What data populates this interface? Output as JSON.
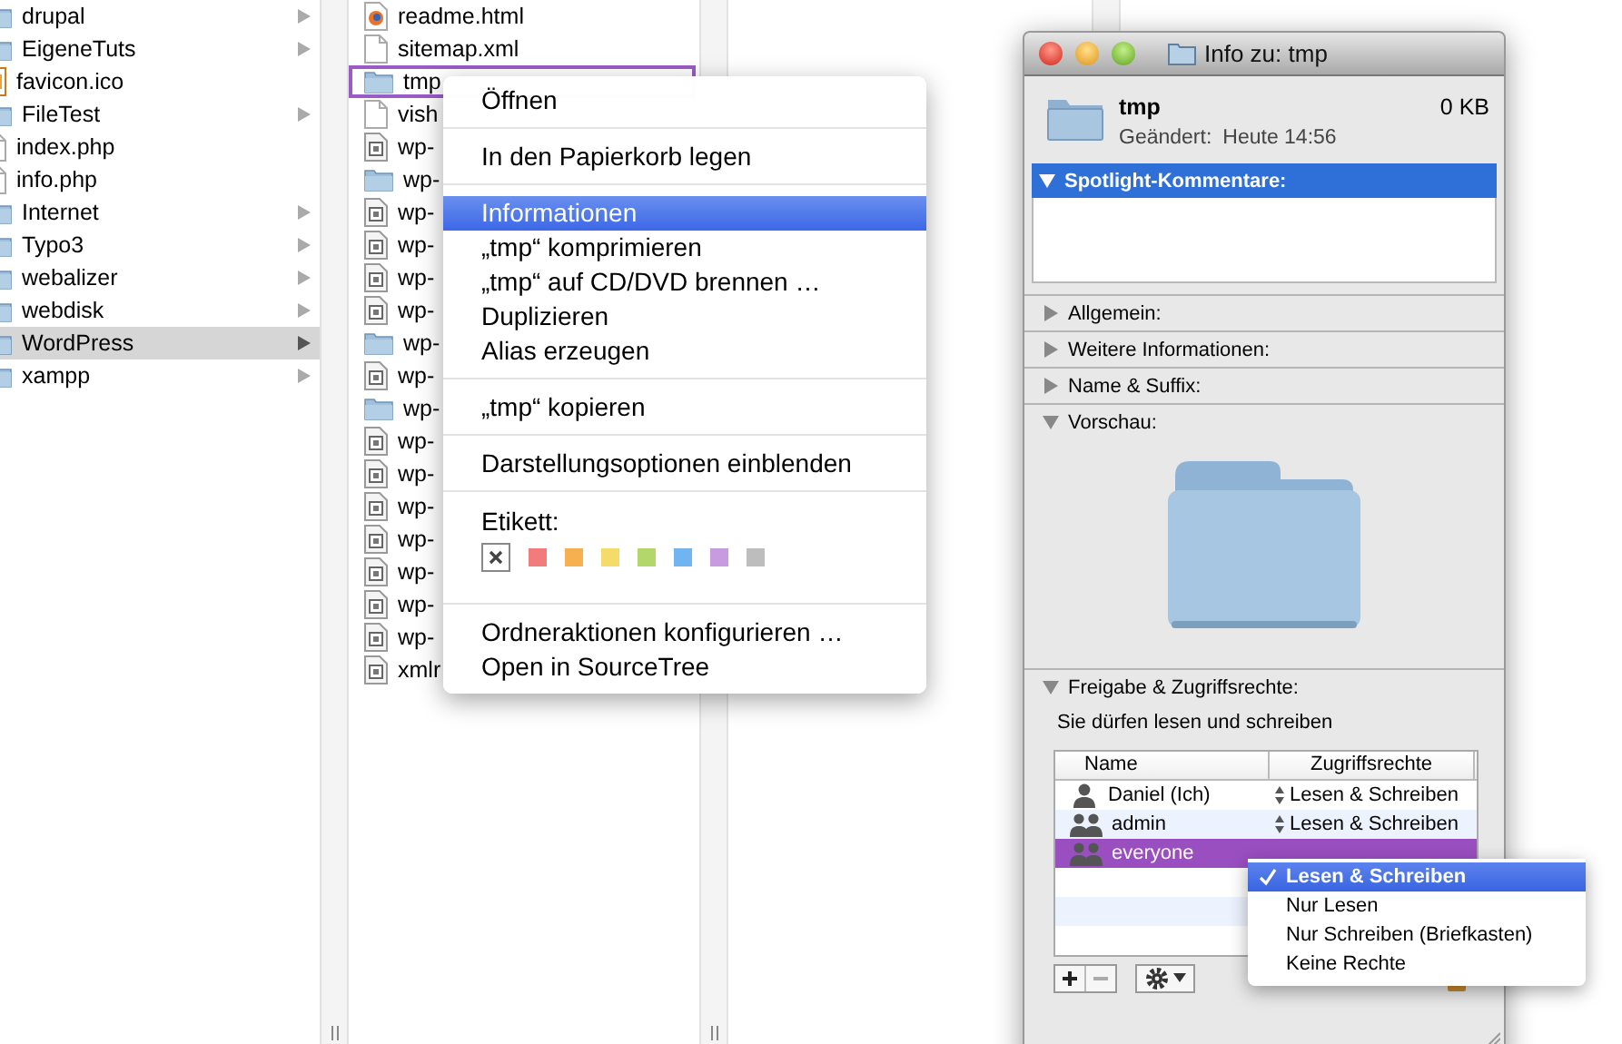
{
  "columns": [
    {
      "items": [
        {
          "name": "drupal",
          "kind": "folder",
          "selected": false
        },
        {
          "name": "EigeneTuts",
          "kind": "folder",
          "selected": false
        },
        {
          "name": "favicon.ico",
          "kind": "image",
          "selected": false
        },
        {
          "name": "FileTest",
          "kind": "folder",
          "selected": false
        },
        {
          "name": "index.php",
          "kind": "document",
          "selected": false
        },
        {
          "name": "info.php",
          "kind": "document",
          "selected": false
        },
        {
          "name": "Internet",
          "kind": "folder",
          "selected": false
        },
        {
          "name": "Typo3",
          "kind": "folder",
          "selected": false
        },
        {
          "name": "webalizer",
          "kind": "folder",
          "selected": false
        },
        {
          "name": "webdisk",
          "kind": "folder",
          "selected": false
        },
        {
          "name": "WordPress",
          "kind": "folder",
          "selected": true
        },
        {
          "name": "xampp",
          "kind": "folder",
          "selected": false
        }
      ]
    },
    {
      "items": [
        {
          "name": "readme.html",
          "kind": "web",
          "selected": false
        },
        {
          "name": "sitemap.xml",
          "kind": "document",
          "selected": false
        },
        {
          "name": "tmp",
          "kind": "folder",
          "selected": true
        },
        {
          "name": "vish",
          "kind": "document",
          "selected": false
        },
        {
          "name": "wp-",
          "kind": "script",
          "selected": false
        },
        {
          "name": "wp-",
          "kind": "folder",
          "selected": false
        },
        {
          "name": "wp-",
          "kind": "script",
          "selected": false
        },
        {
          "name": "wp-",
          "kind": "script",
          "selected": false
        },
        {
          "name": "wp-",
          "kind": "script",
          "selected": false
        },
        {
          "name": "wp-",
          "kind": "script",
          "selected": false
        },
        {
          "name": "wp-",
          "kind": "folder",
          "selected": false
        },
        {
          "name": "wp-",
          "kind": "script",
          "selected": false
        },
        {
          "name": "wp-",
          "kind": "folder",
          "selected": false
        },
        {
          "name": "wp-",
          "kind": "script",
          "selected": false
        },
        {
          "name": "wp-",
          "kind": "script",
          "selected": false
        },
        {
          "name": "wp-",
          "kind": "script",
          "selected": false
        },
        {
          "name": "wp-",
          "kind": "script",
          "selected": false
        },
        {
          "name": "wp-",
          "kind": "script",
          "selected": false
        },
        {
          "name": "wp-",
          "kind": "script",
          "selected": false
        },
        {
          "name": "wp-",
          "kind": "script",
          "selected": false
        },
        {
          "name": "xmlr",
          "kind": "script",
          "selected": false
        }
      ]
    }
  ],
  "context_menu": {
    "groups": [
      {
        "kind": "items",
        "items": [
          {
            "label": "Öffnen",
            "selected": false
          }
        ]
      },
      {
        "kind": "items",
        "items": [
          {
            "label": "In den Papierkorb legen",
            "selected": false
          }
        ]
      },
      {
        "kind": "items",
        "items": [
          {
            "label": "Informationen",
            "selected": true
          },
          {
            "label": "„tmp“ komprimieren",
            "selected": false
          },
          {
            "label": "„tmp“ auf CD/DVD brennen …",
            "selected": false
          },
          {
            "label": "Duplizieren",
            "selected": false
          },
          {
            "label": "Alias erzeugen",
            "selected": false
          }
        ]
      },
      {
        "kind": "items",
        "items": [
          {
            "label": "„tmp“ kopieren",
            "selected": false
          }
        ]
      },
      {
        "kind": "items",
        "items": [
          {
            "label": "Darstellungsoptionen einblenden",
            "selected": false
          }
        ]
      },
      {
        "kind": "labels",
        "title": "Etikett:",
        "colors": [
          {
            "kind": "none",
            "selected": true
          },
          {
            "color": "#f27c7c",
            "kind": "color",
            "selected": false
          },
          {
            "color": "#f7b04f",
            "kind": "color",
            "selected": false
          },
          {
            "color": "#f5dc6a",
            "kind": "color",
            "selected": false
          },
          {
            "color": "#b3d76a",
            "kind": "color",
            "selected": false
          },
          {
            "color": "#71b4f2",
            "kind": "color",
            "selected": false
          },
          {
            "color": "#c89ae0",
            "kind": "color",
            "selected": false
          },
          {
            "color": "#bdbdbd",
            "kind": "color",
            "selected": false
          }
        ]
      },
      {
        "kind": "items",
        "items": [
          {
            "label": "Ordneraktionen konfigurieren …",
            "selected": false
          },
          {
            "label": "Open in SourceTree",
            "selected": false
          }
        ]
      }
    ]
  },
  "info_window": {
    "title": "Info zu: tmp",
    "name": "tmp",
    "size": "0 KB",
    "modified_label": "Geändert:",
    "modified_value": "Heute 14:56",
    "sections": [
      {
        "title": "Spotlight-Kommentare:",
        "kind": "comments",
        "expanded": true,
        "selected": true
      },
      {
        "title": "Allgemein:",
        "expanded": false,
        "selected": false
      },
      {
        "title": "Weitere Informationen:",
        "expanded": false,
        "selected": false
      },
      {
        "title": "Name & Suffix:",
        "expanded": false,
        "selected": false
      },
      {
        "title": "Vorschau:",
        "kind": "preview",
        "expanded": true,
        "selected": false
      },
      {
        "title": "Freigabe & Zugriffsrechte:",
        "kind": "sharing",
        "expanded": true,
        "selected": false
      }
    ],
    "sharing": {
      "note": "Sie dürfen lesen und schreiben",
      "columns": [
        "Name",
        "Zugriffsrechte"
      ],
      "rows": [
        {
          "name": "Daniel (Ich)",
          "kind": "user",
          "privilege": "Lesen & Schreiben",
          "selected": false
        },
        {
          "name": "admin",
          "kind": "group",
          "privilege": "Lesen & Schreiben",
          "selected": false
        },
        {
          "name": "everyone",
          "kind": "group",
          "selected": true
        }
      ]
    },
    "privilege_menu": {
      "options": [
        {
          "label": "Lesen & Schreiben",
          "checked": true,
          "selected": true
        },
        {
          "label": "Nur Lesen",
          "checked": false,
          "selected": false
        },
        {
          "label": "Nur Schreiben (Briefkasten)",
          "checked": false,
          "selected": false
        },
        {
          "label": "Keine Rechte",
          "checked": false,
          "selected": false
        }
      ]
    }
  }
}
